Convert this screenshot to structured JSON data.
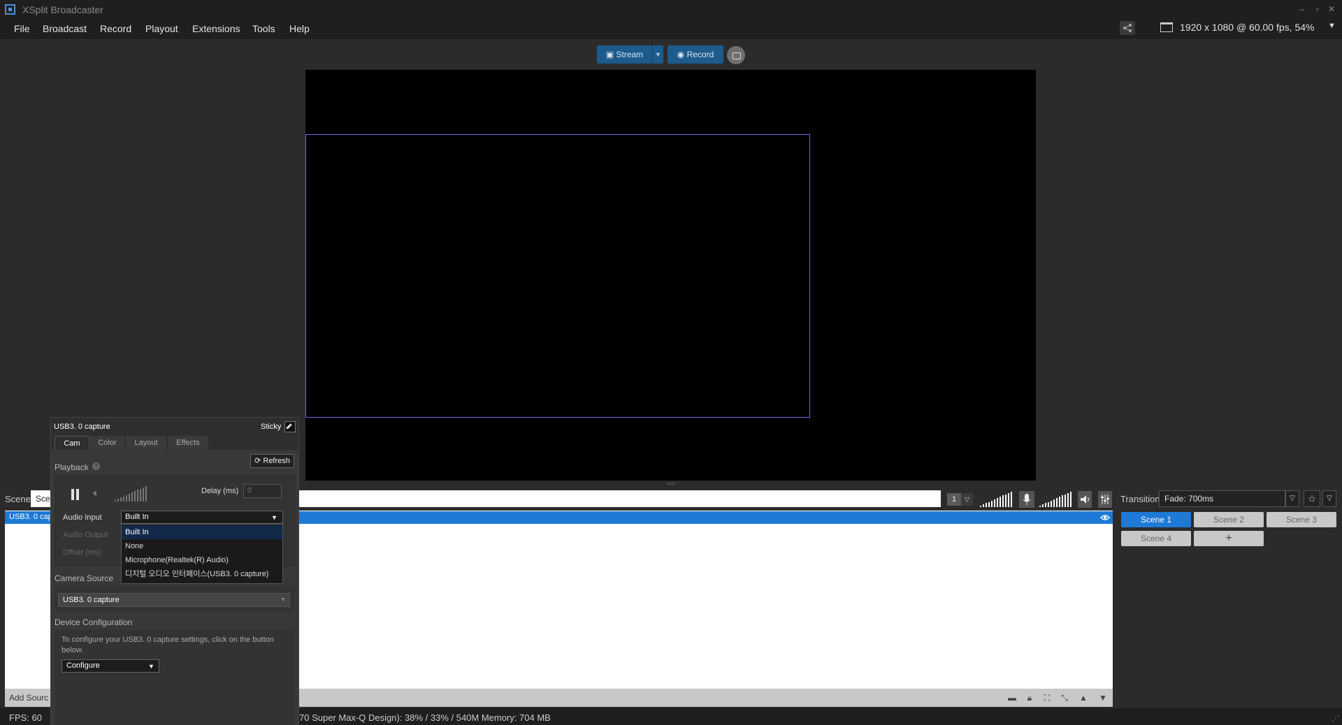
{
  "window": {
    "title": "XSplit Broadcaster"
  },
  "menu": [
    "File",
    "Broadcast",
    "Record",
    "Playout",
    "Extensions",
    "Tools",
    "Help"
  ],
  "resolution": "1920 x 1080 @ 60.00 fps, 54%",
  "toolbar": {
    "stream_label": "Stream",
    "record_label": "Record"
  },
  "scene_bar": {
    "label": "Scene",
    "tab": "Sce",
    "counter": "1"
  },
  "sources": {
    "selected_item": "USB3. 0 cap",
    "add_source": "Add Sourc"
  },
  "transition": {
    "label": "Transition",
    "value": "Fade: 700ms"
  },
  "scenes": [
    "Scene 1",
    "Scene 2",
    "Scene 3",
    "Scene 4"
  ],
  "scene_add": "+",
  "status": {
    "fps": "FPS:  60",
    "gpu": "70 Super Max-Q Design):  38% / 33% / 540M   Memory:  704 MB"
  },
  "props": {
    "title": "USB3. 0 capture",
    "sticky": "Sticky",
    "tabs": [
      "Cam",
      "Color",
      "Layout",
      "Effects"
    ],
    "refresh": "Refresh",
    "playback_label": "Playback",
    "delay_label": "Delay (ms)",
    "delay_value": "0",
    "audio_input_label": "Audio Input",
    "audio_output_label": "Audio Output",
    "offset_label": "Offset (ms)",
    "audio_input_value": "Built In",
    "audio_options": [
      "Built In",
      "None",
      "Microphone(Realtek(R) Audio)",
      "디지털 오디오 인터페이스(USB3. 0 capture)"
    ],
    "camera_source_label": "Camera Source",
    "camera_source_value": "USB3. 0 capture",
    "device_config_label": "Device Configuration",
    "device_config_text": "To configure your USB3. 0 capture settings, click on the button below.",
    "configure": "Configure"
  }
}
